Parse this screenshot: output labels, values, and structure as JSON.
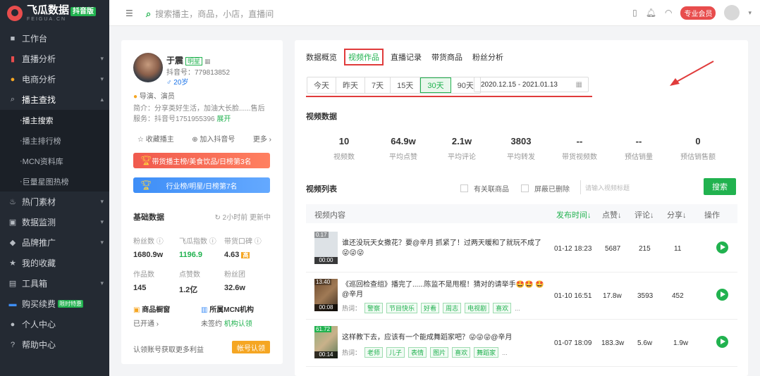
{
  "app": {
    "logo_title": "飞瓜数据",
    "logo_sub": "FEIGUA.CN",
    "logo_badge": "抖音版"
  },
  "sidebar": {
    "items": [
      {
        "label": "工作台"
      },
      {
        "label": "直播分析"
      },
      {
        "label": "电商分析"
      },
      {
        "label": "播主查找"
      },
      {
        "label": "播主搜索"
      },
      {
        "label": "播主排行榜"
      },
      {
        "label": "MCN资料库"
      },
      {
        "label": "巨量星图热榜"
      },
      {
        "label": "热门素材"
      },
      {
        "label": "数据监测"
      },
      {
        "label": "品牌推广"
      },
      {
        "label": "我的收藏"
      },
      {
        "label": "工具箱"
      },
      {
        "label": "购买续费",
        "badge": "限时特惠"
      },
      {
        "label": "个人中心"
      },
      {
        "label": "帮助中心"
      }
    ]
  },
  "topbar": {
    "search_placeholder": "搜索播主，商品，小店，直播间",
    "vip_label": "专业会员"
  },
  "profile": {
    "name": "于震",
    "tag": "明星",
    "uid": "抖音号：779813852",
    "age": "20岁",
    "role": "导演、演员",
    "intro": "简介：分享类好生活，加油大长脸......售后服务：抖音号1751955396",
    "intro_more": "展开",
    "collect": "收藏播主",
    "join": "加入抖音号",
    "more": "更多",
    "rank1": "带货播主榜/美食饮品/日榜第3名",
    "rank2": "行业榜/明星/日榜第7名",
    "basic_title": "基础数据",
    "update_time": "2小时前  更新中",
    "stats": [
      {
        "label": "粉丝数",
        "value": "1680.9w"
      },
      {
        "label": "飞瓜指数",
        "value": "1196.9"
      },
      {
        "label": "带货口碑",
        "value": "4.63"
      },
      {
        "label": "作品数",
        "value": "145"
      },
      {
        "label": "点赞数",
        "value": "1.2亿"
      },
      {
        "label": "粉丝团",
        "value": "32.6w"
      }
    ],
    "showcase_label": "商品橱窗",
    "showcase_value": "已开通",
    "mcn_label": "所属MCN机构",
    "mcn_value": "未签约",
    "mcn_link": "机构认领",
    "claim_text": "认领账号获取更多利益",
    "claim_btn": "帐号认领"
  },
  "main": {
    "tabs": [
      "数据概览",
      "视频作品",
      "直播记录",
      "带货商品",
      "粉丝分析"
    ],
    "days": [
      "今天",
      "昨天",
      "7天",
      "15天",
      "30天",
      "90天"
    ],
    "date_range": "2020.12.15 - 2021.01.13",
    "video_data_title": "视频数据",
    "metrics": [
      {
        "value": "10",
        "label": "视频数"
      },
      {
        "value": "64.9w",
        "label": "平均点赞"
      },
      {
        "value": "2.1w",
        "label": "平均评论"
      },
      {
        "value": "3803",
        "label": "平均转发"
      },
      {
        "value": "--",
        "label": "带货视频数"
      },
      {
        "value": "--",
        "label": "预估销量"
      },
      {
        "value": "0",
        "label": "预估销售额"
      }
    ],
    "video_list_title": "视频列表",
    "chk1": "有关联商品",
    "chk2": "屏蔽已删除",
    "search_placeholder": "请输入视频标题",
    "search_btn": "搜索",
    "headers": [
      "视频内容",
      "发布时间↓",
      "点赞↓",
      "评论↓",
      "分享↓",
      "操作"
    ],
    "rows": [
      {
        "title": "谁还没玩天女撒花？要@辛月 抓紧了！过两天暖和了就玩不成了 😜😜😜",
        "duration": "00:00",
        "score": "0.17",
        "time": "01-12 18:23",
        "likes": "5687",
        "comments": "215",
        "shares": "11"
      },
      {
        "title": "《巡回检查组》播完了......陈监不是甩棍！猜对的请举手🤩🤩 🤩@辛月",
        "hot_label": "热词：",
        "hot": [
          "警察",
          "节目快乐",
          "好看",
          "周志",
          "电视剧",
          "喜欢"
        ],
        "duration": "00:08",
        "score": "13.40",
        "time": "01-10 16:51",
        "likes": "17.8w",
        "comments": "3593",
        "shares": "452"
      },
      {
        "title": "这样教下去，应该有一个能成舞蹈家吧？😜😜😜@辛月",
        "hot_label": "热词：",
        "hot": [
          "老师",
          "儿子",
          "表情",
          "图片",
          "喜欢",
          "舞蹈家"
        ],
        "duration": "00:14",
        "score": "61.72",
        "time": "01-07 18:09",
        "likes": "183.3w",
        "comments": "5.6w",
        "shares": "1.9w"
      }
    ]
  },
  "colors": {
    "accent": "#21b24f",
    "highlight": "#e03b3b",
    "sidebar": "#242a33"
  }
}
